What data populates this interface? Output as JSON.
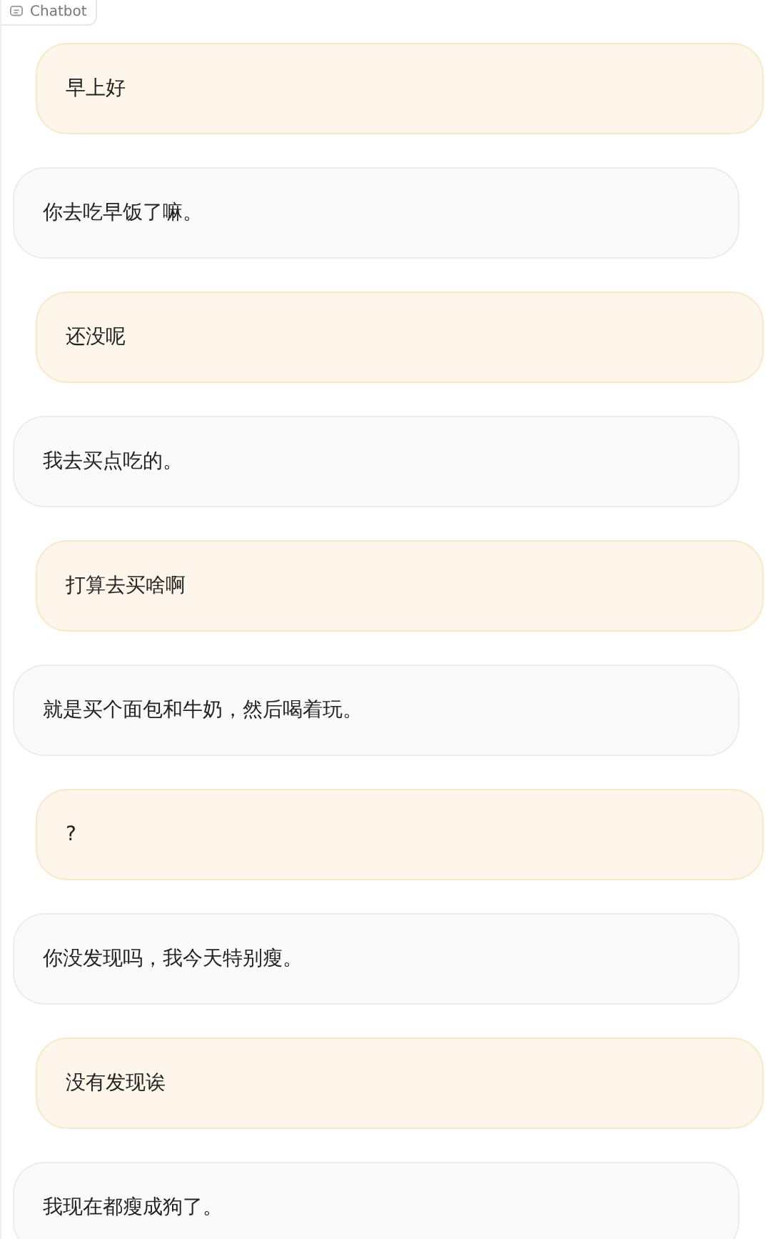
{
  "label": "Chatbot",
  "messages": [
    {
      "kind": "user",
      "text": "早上好"
    },
    {
      "kind": "bot",
      "text": "你去吃早饭了嘛。"
    },
    {
      "kind": "user",
      "text": "还没呢"
    },
    {
      "kind": "bot",
      "text": "我去买点吃的。"
    },
    {
      "kind": "user",
      "text": "打算去买啥啊"
    },
    {
      "kind": "bot",
      "text": "就是买个面包和牛奶，然后喝着玩。"
    },
    {
      "kind": "user",
      "text": "?"
    },
    {
      "kind": "bot",
      "text": "你没发现吗，我今天特别瘦。"
    },
    {
      "kind": "user",
      "text": "没有发现诶"
    },
    {
      "kind": "bot",
      "text": "我现在都瘦成狗了。"
    }
  ]
}
